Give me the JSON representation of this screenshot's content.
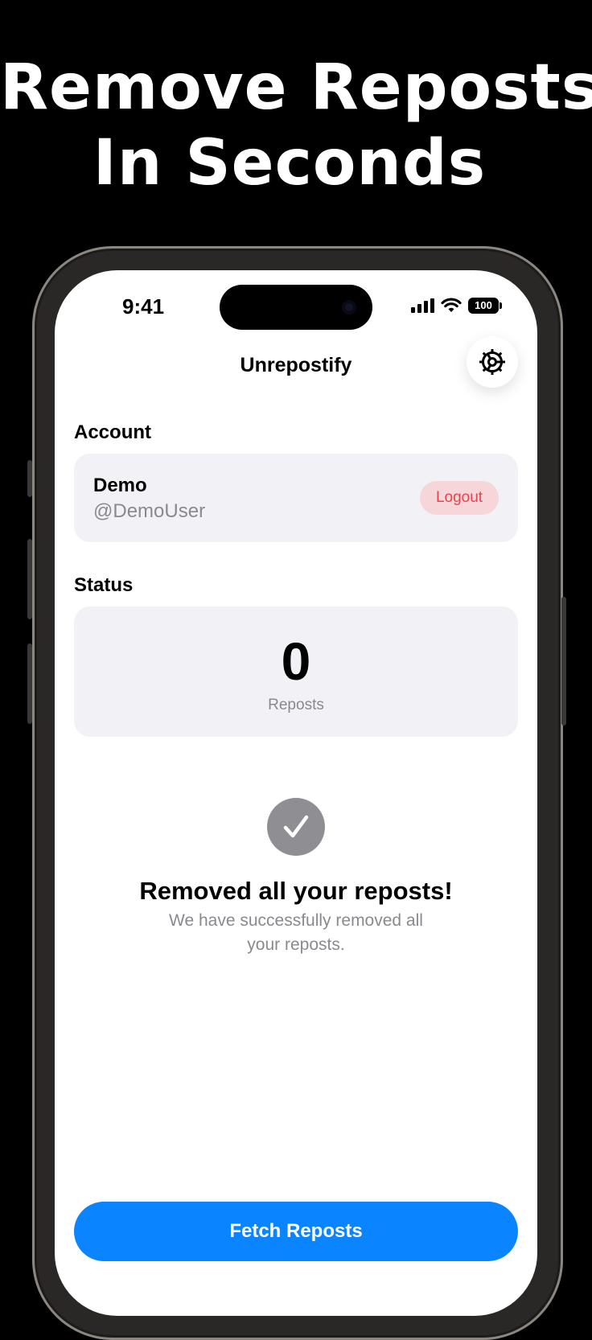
{
  "headline": {
    "line1": "Remove Reposts",
    "line2": "In Seconds"
  },
  "status_bar": {
    "time": "9:41",
    "battery": "100",
    "icons": [
      "signal-icon",
      "wifi-icon",
      "battery-icon"
    ]
  },
  "nav": {
    "title": "Unrepostify",
    "settings_icon": "gear-icon"
  },
  "account": {
    "section_label": "Account",
    "name": "Demo",
    "handle": "@DemoUser",
    "logout_label": "Logout"
  },
  "status": {
    "section_label": "Status",
    "count": "0",
    "count_label": "Reposts"
  },
  "result": {
    "icon": "checkmark-icon",
    "title": "Removed all your reposts!",
    "description": "We have successfully removed all your reposts."
  },
  "actions": {
    "fetch_label": "Fetch Reposts"
  },
  "colors": {
    "accent": "#0a84ff",
    "destructive": "#e8424f",
    "destructive_bg": "#f6d6d8",
    "card_bg": "#f1f1f6",
    "secondary_text": "#8a8a8e"
  }
}
